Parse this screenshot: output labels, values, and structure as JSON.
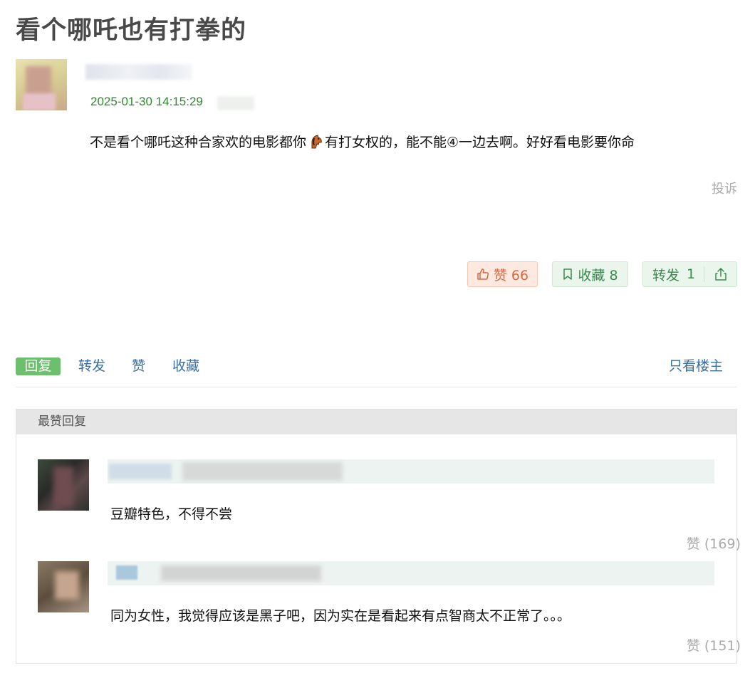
{
  "post": {
    "title": "看个哪吒也有打拳的",
    "time": "2025-01-30 14:15:29",
    "body_before": "不是看个哪吒这种合家欢的电影都你",
    "body_emoji": "horse-emoji",
    "body_after": "有打女权的，能不能④一边去啊。好好看电影要你命",
    "report_label": "投诉"
  },
  "stats": {
    "like_label": "赞 66",
    "fav_label": "收藏 8",
    "share_label": "转发",
    "share_count": "1"
  },
  "actions": {
    "reply": "回复",
    "forward": "转发",
    "like": "赞",
    "fav": "收藏",
    "op_only": "只看楼主"
  },
  "best_replies": {
    "header": "最赞回复",
    "items": [
      {
        "text": "豆瓣特色，不得不尝",
        "likes": "赞 (169)"
      },
      {
        "text": "同为女性，我觉得应该是黑子吧，因为实在是看起来有点智商太不正常了。。。",
        "likes": "赞 (151)"
      }
    ]
  },
  "colors": {
    "time_green": "#2f8a2f",
    "link_blue": "#3a6f9f",
    "reply_green": "#6cbf6c",
    "like_orange": "#d46b45"
  }
}
